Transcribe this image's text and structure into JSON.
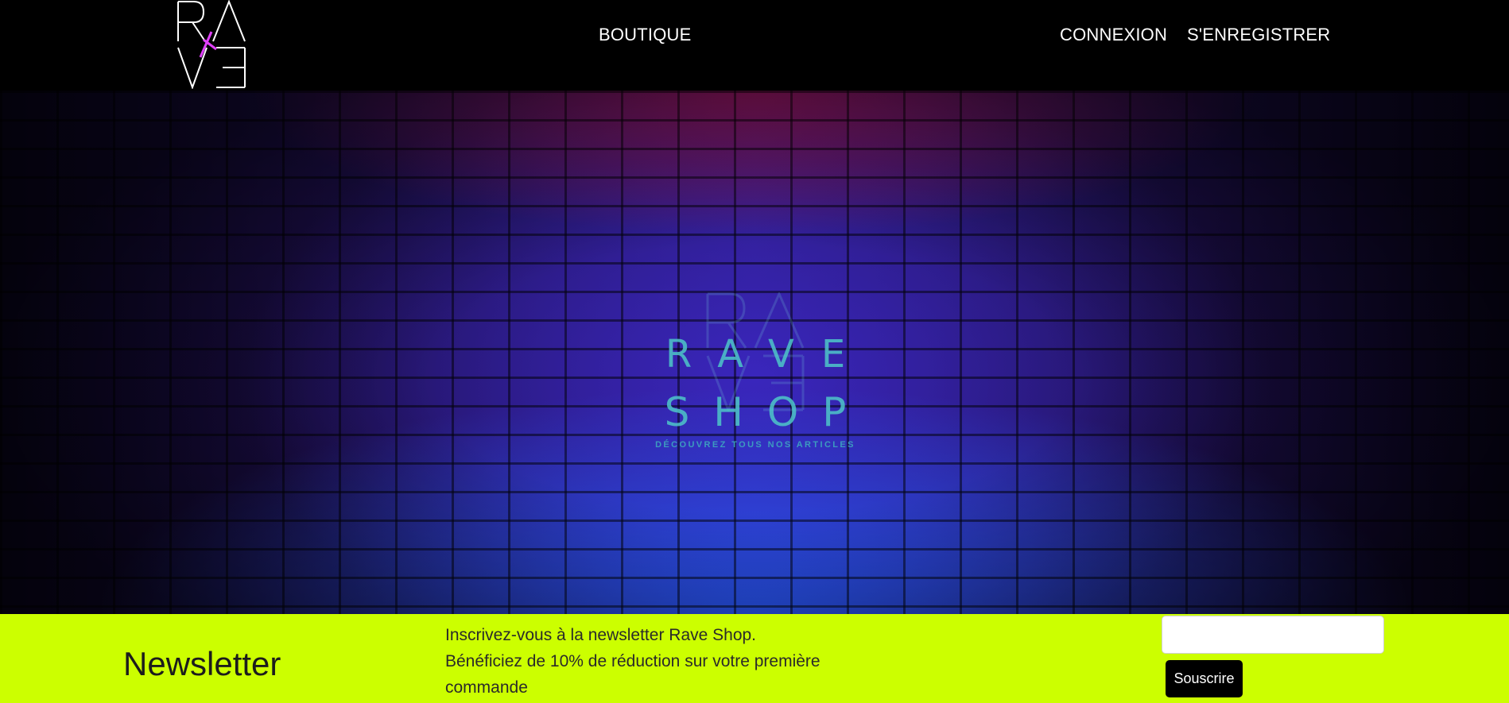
{
  "nav": {
    "logo_text": "RAVE",
    "boutique": "BOUTIQUE",
    "connexion": "CONNEXION",
    "register": "S'ENREGISTRER"
  },
  "hero": {
    "brand_line1": "RAVE",
    "brand_line2": "SHOP",
    "tagline": "DÉCOUVREZ TOUS NOS ARTICLES"
  },
  "newsletter": {
    "title": "Newsletter",
    "line1": "Inscrivez-vous à la newsletter Rave Shop.",
    "line2": "Bénéficiez de 10% de réduction sur votre première commande",
    "input_value": "",
    "button_label": "Souscrire"
  },
  "colors": {
    "navbar_bg": "#000000",
    "newsletter_bg": "#ccff00",
    "logo_accent": "#e040fb",
    "hero_text": "#4ec7c9"
  }
}
